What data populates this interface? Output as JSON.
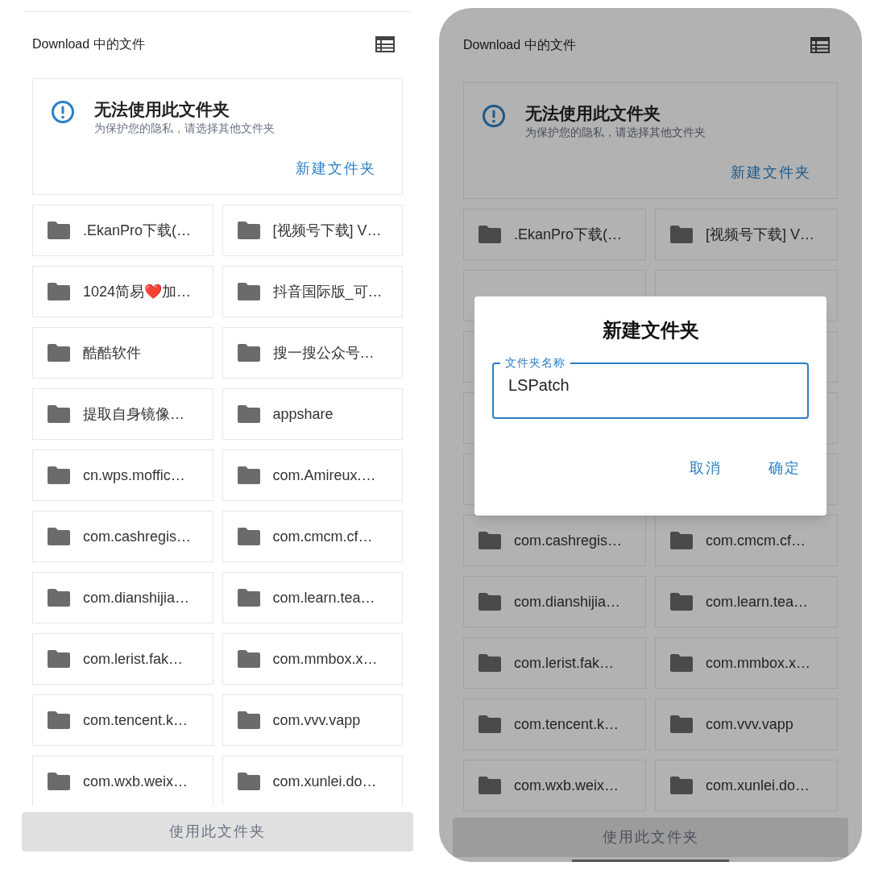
{
  "screens": [
    {
      "header": {
        "title": "Download 中的文件"
      },
      "notice": {
        "title": "无法使用此文件夹",
        "message": "为保护您的隐私，请选择其他文件夹",
        "action": "新建文件夹"
      },
      "folders": [
        {
          "kind": "folder",
          "name": ".EkanPro下载(…"
        },
        {
          "kind": "folder",
          "name": "[视频号下载] V…"
        },
        {
          "kind": "folder",
          "name": "1024简易❤️加…"
        },
        {
          "kind": "folder",
          "name": "抖音国际版_可…"
        },
        {
          "kind": "folder",
          "name": "酷酷软件"
        },
        {
          "kind": "folder",
          "name": "搜一搜公众号…"
        },
        {
          "kind": "folder",
          "name": "提取自身镜像…"
        },
        {
          "kind": "folder",
          "name": "appshare"
        },
        {
          "kind": "folder",
          "name": "cn.wps.moffic…"
        },
        {
          "kind": "folder",
          "name": "com.Amireux.…"
        },
        {
          "kind": "folder",
          "name": "com.cashregis…"
        },
        {
          "kind": "folder",
          "name": "com.cmcm.cf…"
        },
        {
          "kind": "folder",
          "name": "com.dianshijia…"
        },
        {
          "kind": "folder",
          "name": "com.learn.tea…"
        },
        {
          "kind": "folder",
          "name": "com.lerist.fak…"
        },
        {
          "kind": "folder",
          "name": "com.mmbox.x…"
        },
        {
          "kind": "folder",
          "name": "com.tencent.k…"
        },
        {
          "kind": "folder",
          "name": "com.vvv.vapp"
        },
        {
          "kind": "folder",
          "name": "com.wxb.weix…"
        },
        {
          "kind": "folder",
          "name": "com.xunlei.do…"
        }
      ],
      "use_button": {
        "label": "使用此文件夹",
        "disabled": true
      }
    },
    {
      "header": {
        "title": "Download 中的文件"
      },
      "notice": {
        "title": "无法使用此文件夹",
        "message": "为保护您的隐私，请选择其他文件夹",
        "action": "新建文件夹"
      },
      "folders": [
        {
          "kind": "folder",
          "name": ".EkanPro下载(…"
        },
        {
          "kind": "folder",
          "name": "[视频号下载] V…"
        },
        {
          "kind": "covered"
        },
        {
          "kind": "covered"
        },
        {
          "kind": "covered"
        },
        {
          "kind": "covered"
        },
        {
          "kind": "covered"
        },
        {
          "kind": "covered"
        },
        {
          "kind": "covered"
        },
        {
          "kind": "covered"
        },
        {
          "kind": "folder",
          "name": "com.cashregis…"
        },
        {
          "kind": "folder",
          "name": "com.cmcm.cf…"
        },
        {
          "kind": "folder",
          "name": "com.dianshijia…"
        },
        {
          "kind": "folder",
          "name": "com.learn.tea…"
        },
        {
          "kind": "folder",
          "name": "com.lerist.fak…"
        },
        {
          "kind": "folder",
          "name": "com.mmbox.x…"
        },
        {
          "kind": "folder",
          "name": "com.tencent.k…"
        },
        {
          "kind": "folder",
          "name": "com.vvv.vapp"
        },
        {
          "kind": "folder",
          "name": "com.wxb.weix…"
        },
        {
          "kind": "folder",
          "name": "com.xunlei.do…"
        }
      ],
      "use_button": {
        "label": "使用此文件夹",
        "disabled": true
      },
      "dialog": {
        "title": "新建文件夹",
        "field": {
          "label": "文件夹名称",
          "value": "LSPatch"
        },
        "buttons": [
          "取消",
          "确定"
        ]
      }
    }
  ]
}
